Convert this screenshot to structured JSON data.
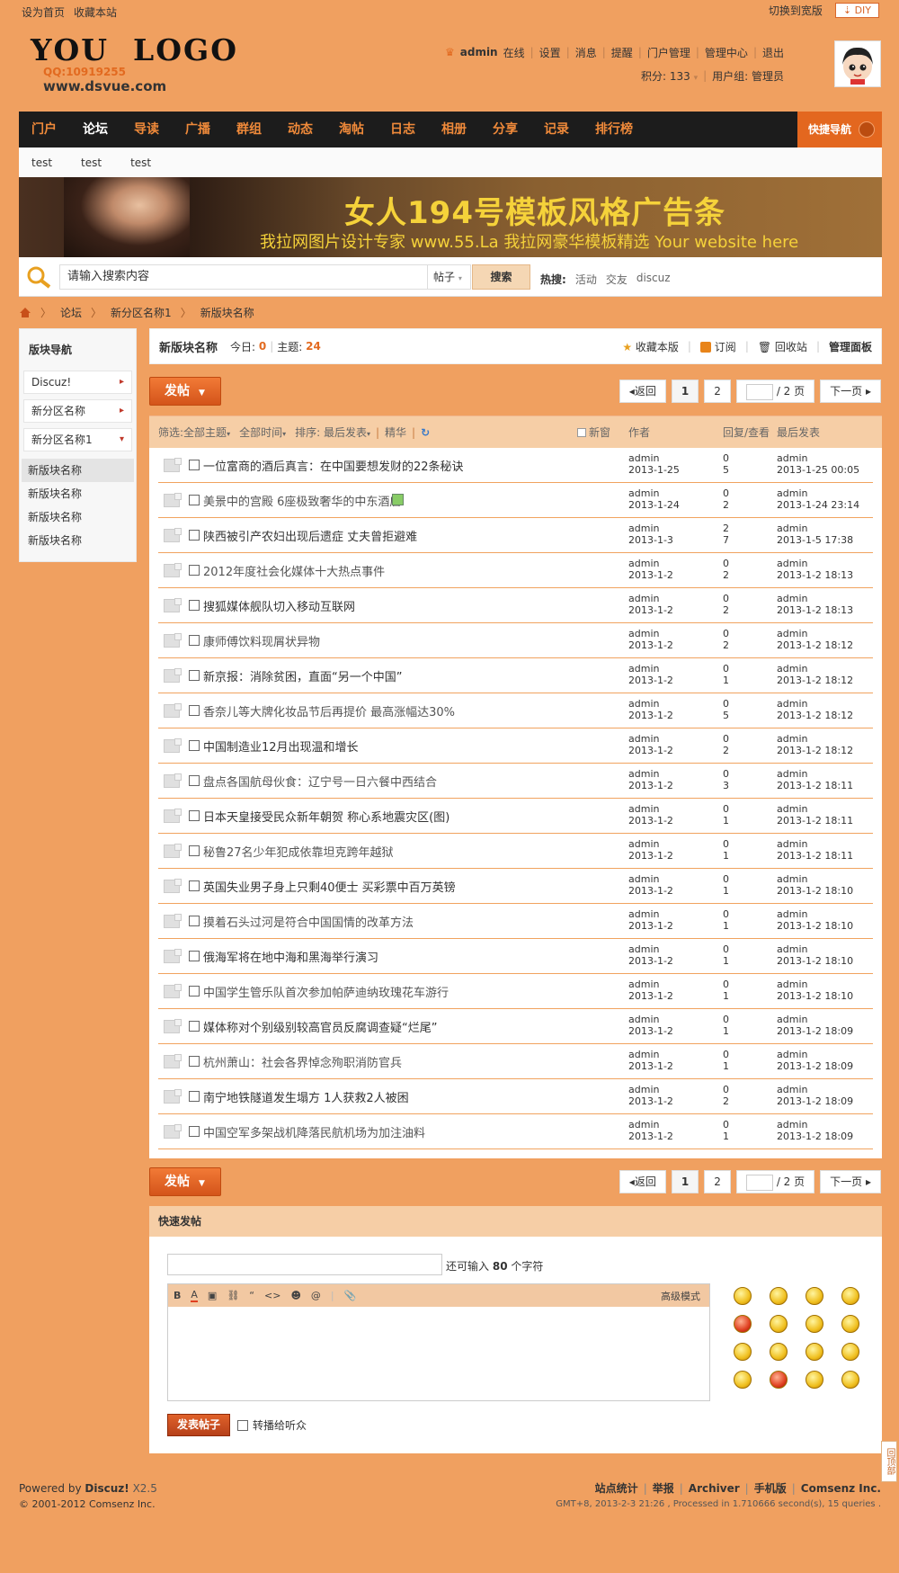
{
  "topbar": {
    "set_home": "设为首页",
    "favorite": "收藏本站",
    "wide": "切换到宽版",
    "diy": "DIY"
  },
  "logo": {
    "main": "YOU  LOGO",
    "qq": "QQ:10919255",
    "url": "www.dsvue.com"
  },
  "user": {
    "name": "admin",
    "status": "在线",
    "links": [
      "设置",
      "消息",
      "提醒",
      "门户管理",
      "管理中心",
      "退出"
    ],
    "points_label": "积分: 133",
    "group_label": "用户组: 管理员"
  },
  "nav": {
    "items": [
      "门户",
      "论坛",
      "导读",
      "广播",
      "群组",
      "动态",
      "淘帖",
      "日志",
      "相册",
      "分享",
      "记录",
      "排行榜"
    ],
    "current": "论坛",
    "quick": "快捷导航"
  },
  "subnav": [
    "test",
    "test",
    "test"
  ],
  "banner": {
    "title": "女人194号模板风格广告条",
    "subtitle": "我拉网图片设计专家 www.55.La 我拉网豪华模板精选 Your website here"
  },
  "search": {
    "placeholder": "请输入搜索内容",
    "type": "帖子",
    "button": "搜索",
    "hot_label": "热搜:",
    "hot": [
      "活动",
      "交友",
      "discuz"
    ]
  },
  "breadcrumb": [
    "论坛",
    "新分区名称1",
    "新版块名称"
  ],
  "sidebar": {
    "title": "版块导航",
    "cats": [
      "Discuz!",
      "新分区名称",
      "新分区名称1"
    ],
    "items": [
      "新版块名称",
      "新版块名称",
      "新版块名称",
      "新版块名称"
    ]
  },
  "forum": {
    "name": "新版块名称",
    "today_label": "今日:",
    "today": "0",
    "threads_label": "主题:",
    "threads": "24",
    "tools": [
      "收藏本版",
      "订阅",
      "回收站",
      "管理面板"
    ]
  },
  "actions": {
    "post": "发帖",
    "back": "返回",
    "page1": "1",
    "page2": "2",
    "total": "/ 2 页",
    "next": "下一页"
  },
  "thead": {
    "filter": "筛选:",
    "all_threads": "全部主题",
    "all_time": "全部时间",
    "sort": "排序: 最后发表",
    "digest": "精华",
    "new_window": "新窗",
    "author": "作者",
    "replies": "回复/查看",
    "lastpost": "最后发表"
  },
  "threads": [
    {
      "title": "一位富商的酒后真言：在中国要想发财的22条秘诀",
      "author": "admin",
      "date": "2013-1-25",
      "replies": "0",
      "views": "5",
      "last_user": "admin",
      "last_time": "2013-1-25 00:05"
    },
    {
      "title": "美景中的宫殿 6座极致奢华的中东酒店",
      "author": "admin",
      "date": "2013-1-24",
      "replies": "0",
      "views": "2",
      "last_user": "admin",
      "last_time": "2013-1-24 23:14"
    },
    {
      "title": "陕西被引产农妇出现后遗症 丈夫曾拒避难",
      "author": "admin",
      "date": "2013-1-3",
      "replies": "2",
      "views": "7",
      "last_user": "admin",
      "last_time": "2013-1-5 17:38"
    },
    {
      "title": "2012年度社会化媒体十大热点事件",
      "author": "admin",
      "date": "2013-1-2",
      "replies": "0",
      "views": "2",
      "last_user": "admin",
      "last_time": "2013-1-2 18:13"
    },
    {
      "title": "搜狐媒体舰队切入移动互联网",
      "author": "admin",
      "date": "2013-1-2",
      "replies": "0",
      "views": "2",
      "last_user": "admin",
      "last_time": "2013-1-2 18:13"
    },
    {
      "title": "康师傅饮料现屑状异物",
      "author": "admin",
      "date": "2013-1-2",
      "replies": "0",
      "views": "2",
      "last_user": "admin",
      "last_time": "2013-1-2 18:12"
    },
    {
      "title": "新京报：消除贫困，直面“另一个中国”",
      "author": "admin",
      "date": "2013-1-2",
      "replies": "0",
      "views": "1",
      "last_user": "admin",
      "last_time": "2013-1-2 18:12"
    },
    {
      "title": "香奈儿等大牌化妆品节后再提价 最高涨幅达30%",
      "author": "admin",
      "date": "2013-1-2",
      "replies": "0",
      "views": "5",
      "last_user": "admin",
      "last_time": "2013-1-2 18:12"
    },
    {
      "title": "中国制造业12月出现温和增长",
      "author": "admin",
      "date": "2013-1-2",
      "replies": "0",
      "views": "2",
      "last_user": "admin",
      "last_time": "2013-1-2 18:12"
    },
    {
      "title": "盘点各国航母伙食：辽宁号一日六餐中西结合",
      "author": "admin",
      "date": "2013-1-2",
      "replies": "0",
      "views": "3",
      "last_user": "admin",
      "last_time": "2013-1-2 18:11"
    },
    {
      "title": "日本天皇接受民众新年朝贺 称心系地震灾区(图)",
      "author": "admin",
      "date": "2013-1-2",
      "replies": "0",
      "views": "1",
      "last_user": "admin",
      "last_time": "2013-1-2 18:11"
    },
    {
      "title": "秘鲁27名少年犯成依靠坦克跨年越狱",
      "author": "admin",
      "date": "2013-1-2",
      "replies": "0",
      "views": "1",
      "last_user": "admin",
      "last_time": "2013-1-2 18:11"
    },
    {
      "title": "英国失业男子身上只剩40便士 买彩票中百万英镑",
      "author": "admin",
      "date": "2013-1-2",
      "replies": "0",
      "views": "1",
      "last_user": "admin",
      "last_time": "2013-1-2 18:10"
    },
    {
      "title": "摸着石头过河是符合中国国情的改革方法",
      "author": "admin",
      "date": "2013-1-2",
      "replies": "0",
      "views": "1",
      "last_user": "admin",
      "last_time": "2013-1-2 18:10"
    },
    {
      "title": "俄海军将在地中海和黑海举行演习",
      "author": "admin",
      "date": "2013-1-2",
      "replies": "0",
      "views": "1",
      "last_user": "admin",
      "last_time": "2013-1-2 18:10"
    },
    {
      "title": "中国学生管乐队首次参加帕萨迪纳玫瑰花车游行",
      "author": "admin",
      "date": "2013-1-2",
      "replies": "0",
      "views": "1",
      "last_user": "admin",
      "last_time": "2013-1-2 18:10"
    },
    {
      "title": "媒体称对个别级别较高官员反腐调查疑“烂尾”",
      "author": "admin",
      "date": "2013-1-2",
      "replies": "0",
      "views": "1",
      "last_user": "admin",
      "last_time": "2013-1-2 18:09"
    },
    {
      "title": "杭州萧山：社会各界悼念殉职消防官兵",
      "author": "admin",
      "date": "2013-1-2",
      "replies": "0",
      "views": "1",
      "last_user": "admin",
      "last_time": "2013-1-2 18:09"
    },
    {
      "title": "南宁地铁隧道发生塌方 1人获救2人被困",
      "author": "admin",
      "date": "2013-1-2",
      "replies": "0",
      "views": "2",
      "last_user": "admin",
      "last_time": "2013-1-2 18:09"
    },
    {
      "title": "中国空军多架战机降落民航机场为加注油料",
      "author": "admin",
      "date": "2013-1-2",
      "replies": "0",
      "views": "1",
      "last_user": "admin",
      "last_time": "2013-1-2 18:09"
    }
  ],
  "quickpost": {
    "title": "快速发帖",
    "hint_pre": "还可输入",
    "hint_num": "80",
    "hint_post": "个字符",
    "advanced": "高级模式",
    "submit": "发表帖子",
    "forward": "转播给听众"
  },
  "footer": {
    "powered": "Powered by",
    "brand": "Discuz!",
    "version": "X2.5",
    "copyright": "© 2001-2012 Comsenz Inc.",
    "links": [
      "站点统计",
      "举报",
      "Archiver",
      "手机版",
      "Comsenz Inc."
    ],
    "gmt": "GMT+8, 2013-2-3 21:26 , Processed in 1.710666 second(s), 15 queries ."
  },
  "totop": "回顶部"
}
